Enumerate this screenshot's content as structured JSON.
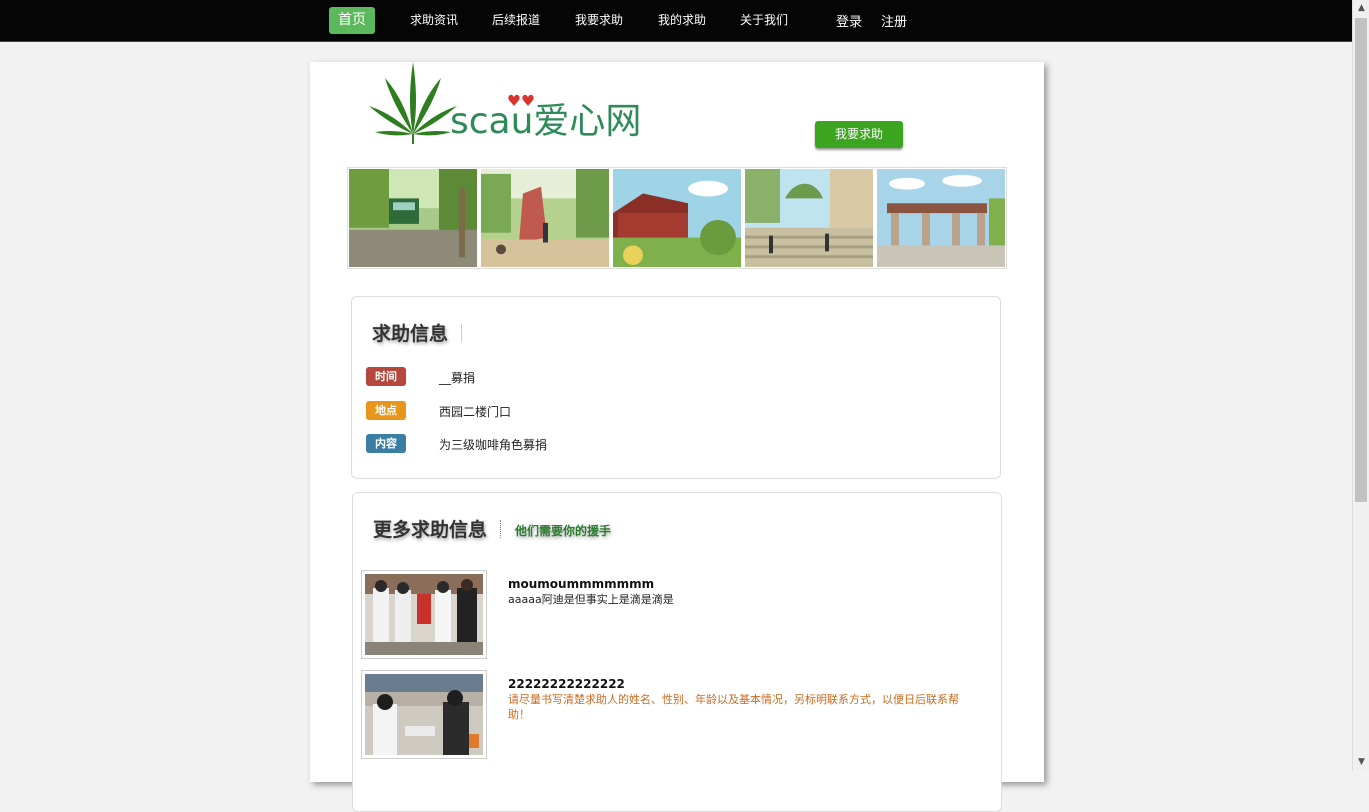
{
  "nav": {
    "items": [
      {
        "label": "首页",
        "active": true
      },
      {
        "label": "求助资讯",
        "active": false
      },
      {
        "label": "后续报道",
        "active": false
      },
      {
        "label": "我要求助",
        "active": false
      },
      {
        "label": "我的求助",
        "active": false
      },
      {
        "label": "关于我们",
        "active": false
      }
    ],
    "login": "登录",
    "register": "注册"
  },
  "header": {
    "logo_text": "scau爱心网",
    "help_button": "我要求助"
  },
  "gallery": {
    "images": [
      "campus-bus-illustration",
      "campus-rock-illustration",
      "campus-building-illustration",
      "campus-stairs-illustration",
      "campus-gate-illustration"
    ]
  },
  "help_info": {
    "title": "求助信息",
    "rows": [
      {
        "label": "时间",
        "value": "__募捐",
        "color": "#b5473f"
      },
      {
        "label": "地点",
        "value": "西园二楼门口",
        "color": "#e8951c"
      },
      {
        "label": "内容",
        "value": "为三级咖啡角色募捐",
        "color": "#3a7fa3"
      }
    ]
  },
  "more_info": {
    "title": "更多求助信息",
    "subtitle": "他们需要你的援手",
    "items": [
      {
        "title": "moumoummmmmmm",
        "desc": "aaaaa阿迪是但事实上是滴是滴是",
        "desc_color": "#222222"
      },
      {
        "title": "22222222222222",
        "desc": "请尽量书写清楚求助人的姓名、性别、年龄以及基本情况，另标明联系方式，以便日后联系帮助！",
        "desc_color": "#cc6a1e"
      }
    ]
  },
  "colors": {
    "accent_green": "#3ca51f",
    "nav_active": "#5cb85c",
    "topbar": "#050505"
  }
}
